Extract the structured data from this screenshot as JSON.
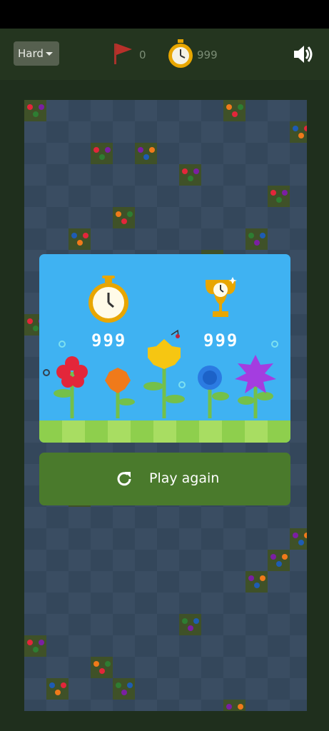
{
  "header": {
    "difficulty": "Hard",
    "flags_remaining": "0",
    "time": "999",
    "icons": {
      "flag": "flag-icon",
      "timer": "stopwatch-icon",
      "sound": "speaker-icon"
    }
  },
  "result": {
    "time_score": "999",
    "best_score": "999",
    "icons": {
      "time": "stopwatch-icon",
      "best": "trophy-icon"
    }
  },
  "play_again": {
    "label": "Play again",
    "icon": "refresh-icon"
  },
  "colors": {
    "background": "#1f2f1d",
    "card_sky": "#3fb2f2",
    "button": "#4a7a2c",
    "flag": "#b8302a",
    "timer": "#e8a600"
  }
}
